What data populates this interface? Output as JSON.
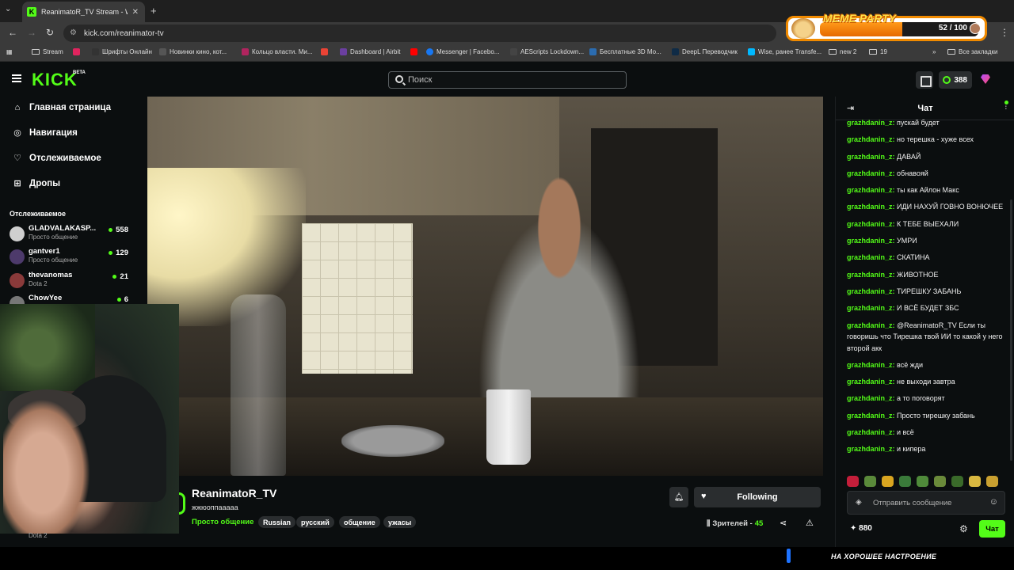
{
  "browser": {
    "tab_title": "ReanimatoR_TV Stream - W",
    "url": "kick.com/reanimator-tv",
    "bookmarks": [
      {
        "label": "Stream",
        "icon": "folder-icon"
      },
      {
        "label": "",
        "icon": "bookmark-icon"
      },
      {
        "label": "Шрифты Онлайн",
        "icon": "bookmark-icon"
      },
      {
        "label": "Новинки кино, кот...",
        "icon": "bookmark-icon"
      },
      {
        "label": "Кольцо власти. Ми...",
        "icon": "bookmark-icon"
      },
      {
        "label": "",
        "icon": "gmail-icon"
      },
      {
        "label": "Dashboard | Airbit",
        "icon": "bookmark-icon"
      },
      {
        "label": "",
        "icon": "youtube-icon"
      },
      {
        "label": "Messenger | Facebo...",
        "icon": "facebook-icon"
      },
      {
        "label": "AEScripts Lockdown...",
        "icon": "bookmark-icon"
      },
      {
        "label": "Бесплатные 3D Мо...",
        "icon": "bookmark-icon"
      },
      {
        "label": "DeepL Переводчик",
        "icon": "bookmark-icon"
      },
      {
        "label": "Wise, ранее Transfe...",
        "icon": "bookmark-icon"
      },
      {
        "label": "new 2",
        "icon": "folder-icon"
      },
      {
        "label": "19",
        "icon": "folder-icon"
      }
    ],
    "all_bookmarks": "Все закладки",
    "more_bookmarks": "»"
  },
  "overlay": {
    "meme_title": "MEME PARTY",
    "meme_count": "52 / 100",
    "meme_progress": 0.52,
    "mood_text": "НА ХОРОШЕЕ НАСТРОЕНИЕ"
  },
  "header": {
    "logo": "KICK",
    "beta": "BETA",
    "search_placeholder": "Поиск",
    "points": "388"
  },
  "sidebar": {
    "nav": [
      {
        "label": "Главная страница",
        "icon": "home-icon"
      },
      {
        "label": "Навигация",
        "icon": "compass-icon"
      },
      {
        "label": "Отслеживаемое",
        "icon": "heart-icon"
      },
      {
        "label": "Дропы",
        "icon": "gift-icon"
      }
    ],
    "following_title": "Отслеживаемое",
    "following": [
      {
        "name": "GLADVALAKASP...",
        "category": "Просто общение",
        "viewers": "558",
        "color": "#cfcfcf"
      },
      {
        "name": "gantver1",
        "category": "Просто общение",
        "viewers": "129",
        "color": "#4d3a6b"
      },
      {
        "name": "thevanomas",
        "category": "Dota 2",
        "viewers": "21",
        "color": "#8a3a3a"
      },
      {
        "name": "ChowYee",
        "category": "",
        "viewers": "6",
        "color": "#777777"
      }
    ],
    "bottom_category": "Dota 2"
  },
  "stream": {
    "streamer": "ReanimatoR_TV",
    "title": "жжюоппааааа",
    "category": "Просто общение",
    "tags": [
      "Russian",
      "русский",
      "общение",
      "ужасы"
    ],
    "follow_label": "Following",
    "viewers_label": "Зрителей -",
    "viewers_count": "45"
  },
  "chat": {
    "title": "Чат",
    "messages": [
      {
        "user": "grazhdanin_z:",
        "text": "пускай будет"
      },
      {
        "user": "grazhdanin_z:",
        "text": "но терешка - хуже всех"
      },
      {
        "user": "grazhdanin_z:",
        "text": "ДАВАЙ"
      },
      {
        "user": "grazhdanin_z:",
        "text": "обнавояй"
      },
      {
        "user": "grazhdanin_z:",
        "text": "ты как Айлон Макс"
      },
      {
        "user": "grazhdanin_z:",
        "text": "ИДИ НАХУЙ ГОВНО ВОНЮЧЕЕ"
      },
      {
        "user": "grazhdanin_z:",
        "text": "К ТЕБЕ ВЫЕХАЛИ"
      },
      {
        "user": "grazhdanin_z:",
        "text": "УМРИ"
      },
      {
        "user": "grazhdanin_z:",
        "text": "СКАТИНА"
      },
      {
        "user": "grazhdanin_z:",
        "text": "ЖИВОТНОЕ"
      },
      {
        "user": "grazhdanin_z:",
        "text": "ТИРЕШКУ ЗАБАНЬ"
      },
      {
        "user": "grazhdanin_z:",
        "text": "И ВСЁ БУДЕТ ЗБС"
      },
      {
        "user": "grazhdanin_z:",
        "text": "@ReanimatoR_TV Если ты говоришь что Тирешка твой ИИ то какой у него второй акк"
      },
      {
        "user": "grazhdanin_z:",
        "text": "всё жди"
      },
      {
        "user": "grazhdanin_z:",
        "text": "не выходи завтра"
      },
      {
        "user": "grazhdanin_z:",
        "text": "а то поговорят"
      },
      {
        "user": "grazhdanin_z:",
        "text": "Просто тирешку забань"
      },
      {
        "user": "grazhdanin_z:",
        "text": "и всё"
      },
      {
        "user": "grazhdanin_z:",
        "text": "и кипера"
      }
    ],
    "input_placeholder": "Отправить сообщение",
    "points": "880",
    "send_label": "Чат"
  },
  "colors": {
    "accent": "#53fc18",
    "background": "#0b0e0f",
    "panel": "#2a2d2f"
  }
}
